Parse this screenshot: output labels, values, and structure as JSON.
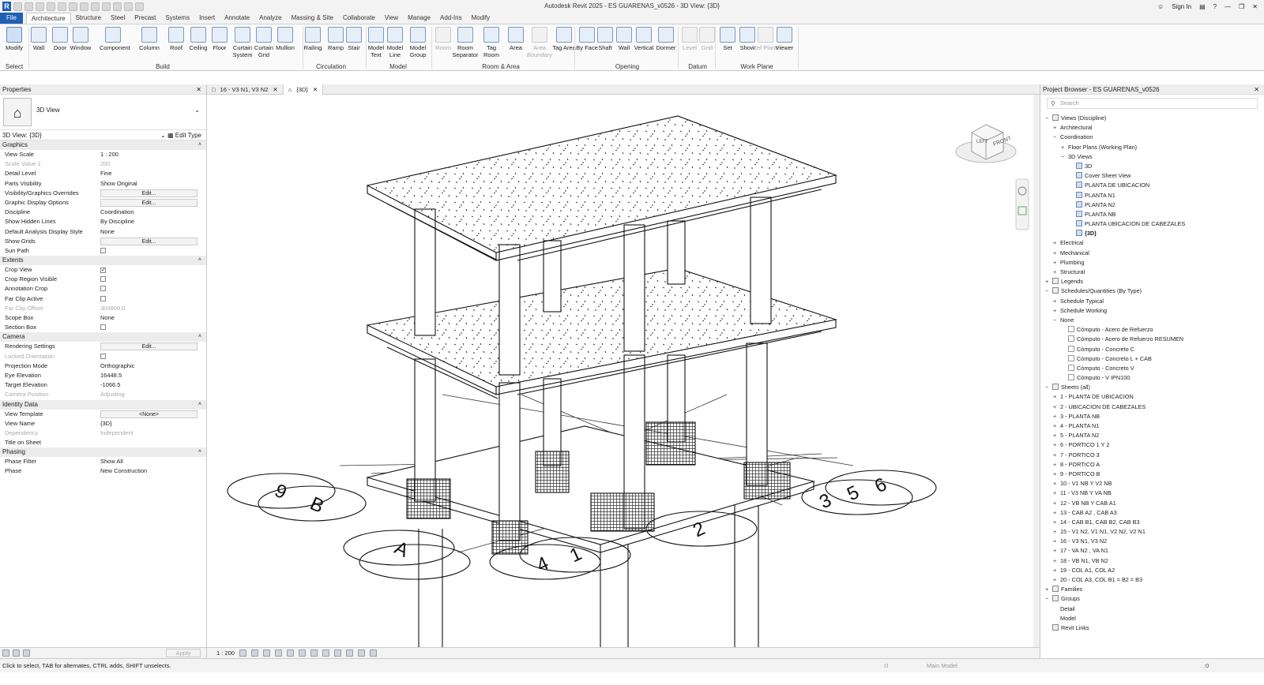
{
  "window": {
    "title": "Autodesk Revit 2025 - ES GUARENAS_v0526 - 3D View: {3D}",
    "sign_in": "Sign In"
  },
  "ribbon_tabs": [
    "File",
    "Architecture",
    "Structure",
    "Steel",
    "Precast",
    "Systems",
    "Insert",
    "Annotate",
    "Analyze",
    "Massing & Site",
    "Collaborate",
    "View",
    "Manage",
    "Add-Ins",
    "Modify"
  ],
  "ribbon": {
    "buttons": [
      {
        "label": "Modify",
        "icon": "cursor-icon"
      },
      {
        "label": "Wall",
        "icon": "wall-icon"
      },
      {
        "label": "Door",
        "icon": "door-icon"
      },
      {
        "label": "Window",
        "icon": "window-icon"
      },
      {
        "label": "Component",
        "icon": "component-icon"
      },
      {
        "label": "Column",
        "icon": "column-icon"
      },
      {
        "label": "Roof",
        "icon": "roof-icon"
      },
      {
        "label": "Ceiling",
        "icon": "ceiling-icon"
      },
      {
        "label": "Floor",
        "icon": "floor-icon"
      },
      {
        "label": "Curtain System",
        "icon": "curtain-system-icon"
      },
      {
        "label": "Curtain Grid",
        "icon": "curtain-grid-icon"
      },
      {
        "label": "Mullion",
        "icon": "mullion-icon"
      },
      {
        "label": "Railing",
        "icon": "railing-icon"
      },
      {
        "label": "Ramp",
        "icon": "ramp-icon"
      },
      {
        "label": "Stair",
        "icon": "stair-icon"
      },
      {
        "label": "Model Text",
        "icon": "model-text-icon"
      },
      {
        "label": "Model Line",
        "icon": "model-line-icon"
      },
      {
        "label": "Model Group",
        "icon": "model-group-icon"
      },
      {
        "label": "Room",
        "icon": "room-icon"
      },
      {
        "label": "Room Separator",
        "icon": "room-separator-icon"
      },
      {
        "label": "Tag Room",
        "icon": "tag-room-icon"
      },
      {
        "label": "Area",
        "icon": "area-icon"
      },
      {
        "label": "Area Boundary",
        "icon": "area-boundary-icon"
      },
      {
        "label": "Tag Area",
        "icon": "tag-area-icon"
      },
      {
        "label": "By Face",
        "icon": "by-face-icon"
      },
      {
        "label": "Shaft",
        "icon": "shaft-icon"
      },
      {
        "label": "Wall",
        "icon": "wall-opening-icon"
      },
      {
        "label": "Vertical",
        "icon": "vertical-opening-icon"
      },
      {
        "label": "Dormer",
        "icon": "dormer-icon"
      },
      {
        "label": "Level",
        "icon": "level-icon"
      },
      {
        "label": "Grid",
        "icon": "grid-icon"
      },
      {
        "label": "Set",
        "icon": "set-workplane-icon"
      },
      {
        "label": "Show",
        "icon": "show-workplane-icon"
      },
      {
        "label": "Ref Plane",
        "icon": "ref-plane-icon"
      },
      {
        "label": "Viewer",
        "icon": "viewer-icon"
      }
    ],
    "panels": [
      "Select",
      "Build",
      "Circulation",
      "Model",
      "Room & Area",
      "Opening",
      "Datum",
      "Work Plane"
    ]
  },
  "properties": {
    "header": "Properties",
    "type_name": "3D View",
    "selector": "3D View: {3D}",
    "edit_type": "Edit Type",
    "groups": [
      {
        "name": "Graphics",
        "rows": [
          {
            "k": "View Scale",
            "v": "1 : 200"
          },
          {
            "k": "Scale Value    1:",
            "v": "200",
            "dim": true
          },
          {
            "k": "Detail Level",
            "v": "Fine"
          },
          {
            "k": "Parts Visibility",
            "v": "Show Original"
          },
          {
            "k": "Visibility/Graphics Overrides",
            "btn": "Edit..."
          },
          {
            "k": "Graphic Display Options",
            "btn": "Edit..."
          },
          {
            "k": "Discipline",
            "v": "Coordination"
          },
          {
            "k": "Show Hidden Lines",
            "v": "By Discipline"
          },
          {
            "k": "Default Analysis Display Style",
            "v": "None"
          },
          {
            "k": "Show Grids",
            "btn": "Edit..."
          },
          {
            "k": "Sun Path",
            "cb": false
          }
        ]
      },
      {
        "name": "Extents",
        "rows": [
          {
            "k": "Crop View",
            "cb": true
          },
          {
            "k": "Crop Region Visible",
            "cb": false
          },
          {
            "k": "Annotation Crop",
            "cb": false
          },
          {
            "k": "Far Clip Active",
            "cb": false
          },
          {
            "k": "Far Clip Offset",
            "v": "304800.0",
            "dim": true
          },
          {
            "k": "Scope Box",
            "v": "None"
          },
          {
            "k": "Section Box",
            "cb": false
          }
        ]
      },
      {
        "name": "Camera",
        "rows": [
          {
            "k": "Rendering Settings",
            "btn": "Edit..."
          },
          {
            "k": "Locked Orientation",
            "cb": false,
            "dim": true
          },
          {
            "k": "Projection Mode",
            "v": "Orthographic"
          },
          {
            "k": "Eye Elevation",
            "v": "16448.5"
          },
          {
            "k": "Target Elevation",
            "v": "-1066.5"
          },
          {
            "k": "Camera Position",
            "v": "Adjusting",
            "dim": true
          }
        ]
      },
      {
        "name": "Identity Data",
        "rows": [
          {
            "k": "View Template",
            "btn": "<None>"
          },
          {
            "k": "View Name",
            "v": "{3D}"
          },
          {
            "k": "Dependency",
            "v": "Independent",
            "dim": true
          },
          {
            "k": "Title on Sheet",
            "v": ""
          }
        ]
      },
      {
        "name": "Phasing",
        "rows": [
          {
            "k": "Phase Filter",
            "v": "Show All"
          },
          {
            "k": "Phase",
            "v": "New Construction"
          }
        ]
      }
    ],
    "apply": "Apply"
  },
  "view_tabs": [
    {
      "label": "16 - V3 N1, V3 N2",
      "active": false
    },
    {
      "label": "{3D}",
      "active": true
    }
  ],
  "viewport": {
    "view_cube_front": "FRONT",
    "view_cube_left": "LEFT",
    "grid_bubbles": [
      "9",
      "B",
      "A",
      "4",
      "1",
      "2",
      "3",
      "5",
      "6"
    ],
    "scale": "1 : 200"
  },
  "browser": {
    "header": "Project Browser - ES GUARENAS_v0526",
    "search_placeholder": "Search",
    "nodes": [
      {
        "t": "Views (Discipline)",
        "d": 0,
        "pm": "−",
        "ic": "gr"
      },
      {
        "t": "Architectural",
        "d": 1,
        "pm": "+"
      },
      {
        "t": "Coordination",
        "d": 1,
        "pm": "−"
      },
      {
        "t": "Floor Plans (Working Plan)",
        "d": 2,
        "pm": "+"
      },
      {
        "t": "3D Views",
        "d": 2,
        "pm": "−"
      },
      {
        "t": "3D",
        "d": 3,
        "ic": "v"
      },
      {
        "t": "Cover Sheet View",
        "d": 3,
        "ic": "v"
      },
      {
        "t": "PLANTA DE UBICACION",
        "d": 3,
        "ic": "v"
      },
      {
        "t": "PLANTA N1",
        "d": 3,
        "ic": "v"
      },
      {
        "t": "PLANTA N2",
        "d": 3,
        "ic": "v"
      },
      {
        "t": "PLANTA NB",
        "d": 3,
        "ic": "v"
      },
      {
        "t": "PLANTA UBICACION DE CABEZALES",
        "d": 3,
        "ic": "v"
      },
      {
        "t": "{3D}",
        "d": 3,
        "ic": "v",
        "b": true
      },
      {
        "t": "Electrical",
        "d": 1,
        "pm": "+"
      },
      {
        "t": "Mechanical",
        "d": 1,
        "pm": "+"
      },
      {
        "t": "Plumbing",
        "d": 1,
        "pm": "+"
      },
      {
        "t": "Structural",
        "d": 1,
        "pm": "+"
      },
      {
        "t": "Legends",
        "d": 0,
        "pm": "+",
        "ic": "gr"
      },
      {
        "t": "Schedules/Quantities (By Type)",
        "d": 0,
        "pm": "−",
        "ic": "gr"
      },
      {
        "t": "Schedule Typical",
        "d": 1,
        "pm": "+"
      },
      {
        "t": "Schedule Working",
        "d": 1,
        "pm": "+"
      },
      {
        "t": "None",
        "d": 1,
        "pm": "−"
      },
      {
        "t": "Cómputo - Acero de Refuerzo",
        "d": 2,
        "ic": "blank"
      },
      {
        "t": "Cómputo - Acero de Refuerzo RESUMEN",
        "d": 2,
        "ic": "blank"
      },
      {
        "t": "Cómputo - Concreto C",
        "d": 2,
        "ic": "blank"
      },
      {
        "t": "Cómputo - Concreto L + CAB",
        "d": 2,
        "ic": "blank"
      },
      {
        "t": "Cómputo - Concreto V",
        "d": 2,
        "ic": "blank"
      },
      {
        "t": "Cómputo - V IPN100",
        "d": 2,
        "ic": "blank"
      },
      {
        "t": "Sheets (all)",
        "d": 0,
        "pm": "−",
        "ic": "gr"
      },
      {
        "t": "1 - PLANTA DE UBICACION",
        "d": 1,
        "pm": "+"
      },
      {
        "t": "2 - UBICACION DE CABEZALES",
        "d": 1,
        "pm": "+"
      },
      {
        "t": "3 - PLANTA NB",
        "d": 1,
        "pm": "+"
      },
      {
        "t": "4 - PLANTA N1",
        "d": 1,
        "pm": "+"
      },
      {
        "t": "5 - PLANTA N2",
        "d": 1,
        "pm": "+"
      },
      {
        "t": "6 - PORTICO 1 Y 2",
        "d": 1,
        "pm": "+"
      },
      {
        "t": "7 - PORTICO 3",
        "d": 1,
        "pm": "+"
      },
      {
        "t": "8 - PORTICO A",
        "d": 1,
        "pm": "+"
      },
      {
        "t": "9 - PORTICO B",
        "d": 1,
        "pm": "+"
      },
      {
        "t": "10 - V1 NB Y V2 NB",
        "d": 1,
        "pm": "+"
      },
      {
        "t": "11 - V3 NB Y VA NB",
        "d": 1,
        "pm": "+"
      },
      {
        "t": "12 - VB NB Y CAB A1",
        "d": 1,
        "pm": "+"
      },
      {
        "t": "13 - CAB A2 , CAB A3",
        "d": 1,
        "pm": "+"
      },
      {
        "t": "14 - CAB B1, CAB B2, CAB B3",
        "d": 1,
        "pm": "+"
      },
      {
        "t": "15 - V1 N2, V1 N1, V2 N2, V2 N1",
        "d": 1,
        "pm": "+"
      },
      {
        "t": "16 - V3 N1, V3 N2",
        "d": 1,
        "pm": "+"
      },
      {
        "t": "17 - VA N2 , VA N1",
        "d": 1,
        "pm": "+"
      },
      {
        "t": "18 - VB N1, VB N2",
        "d": 1,
        "pm": "+"
      },
      {
        "t": "19 - COL A1, COL A2",
        "d": 1,
        "pm": "+"
      },
      {
        "t": "20 - COL A3, COL B1 = B2 = B3",
        "d": 1,
        "pm": "+"
      },
      {
        "t": "Families",
        "d": 0,
        "pm": "+",
        "ic": "gr"
      },
      {
        "t": "Groups",
        "d": 0,
        "pm": "−",
        "ic": "gr"
      },
      {
        "t": "Detail",
        "d": 1
      },
      {
        "t": "Model",
        "d": 1
      },
      {
        "t": "Revit Links",
        "d": 0,
        "ic": "link"
      }
    ]
  },
  "status": {
    "message": "Click to select, TAB for alternates, CTRL adds, SHIFT unselects.",
    "model": "Main Model",
    "zero1": ":0",
    "zero2": ":0"
  }
}
